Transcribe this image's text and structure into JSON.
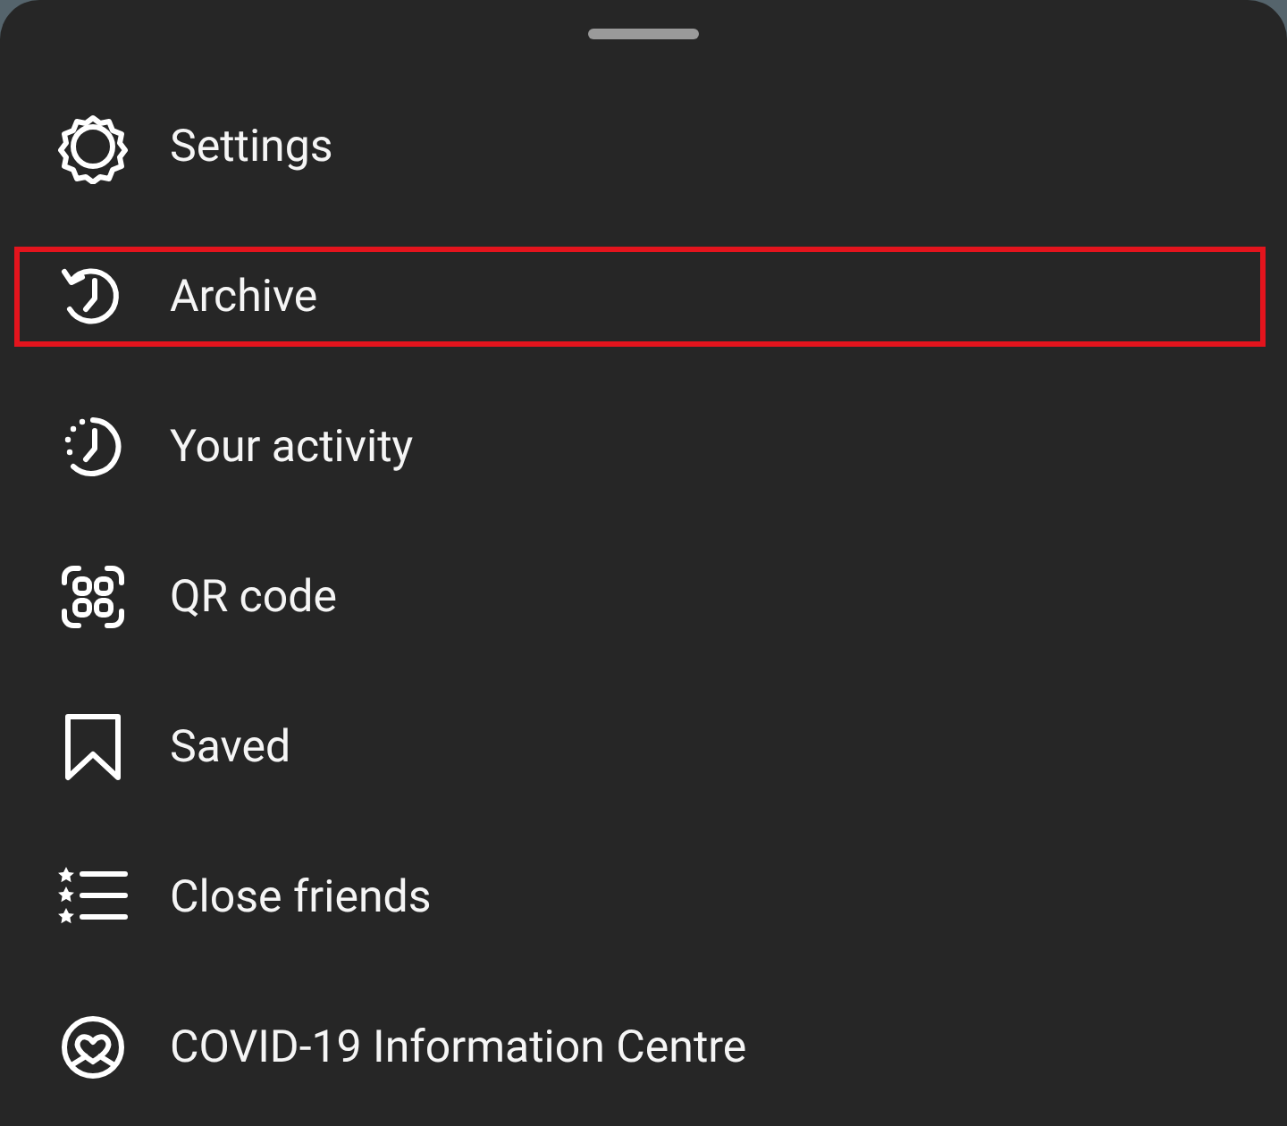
{
  "sheet": {
    "items": [
      {
        "kind": "settings",
        "label": "Settings",
        "highlighted": false
      },
      {
        "kind": "archive",
        "label": "Archive",
        "highlighted": true
      },
      {
        "kind": "activity",
        "label": "Your activity",
        "highlighted": false
      },
      {
        "kind": "qr",
        "label": "QR code",
        "highlighted": false
      },
      {
        "kind": "saved",
        "label": "Saved",
        "highlighted": false
      },
      {
        "kind": "close-friends",
        "label": "Close friends",
        "highlighted": false
      },
      {
        "kind": "covid",
        "label": "COVID-19 Information Centre",
        "highlighted": false
      }
    ]
  }
}
